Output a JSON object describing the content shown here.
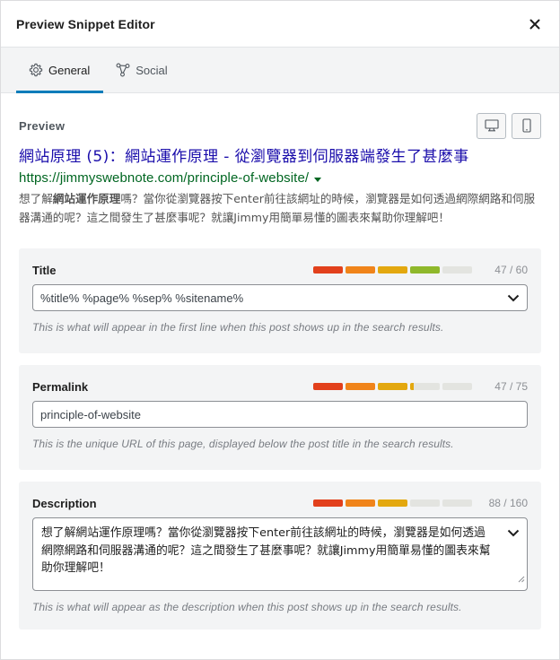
{
  "dialog": {
    "title": "Preview Snippet Editor",
    "close_icon": "close-icon"
  },
  "tabs": [
    {
      "label": "General",
      "icon": "gear-icon",
      "active": true
    },
    {
      "label": "Social",
      "icon": "share-icon",
      "active": false
    }
  ],
  "preview": {
    "label": "Preview",
    "desktop_icon": "desktop-icon",
    "mobile_icon": "mobile-icon",
    "serp": {
      "title": "網站原理 (5)：網站運作原理 - 從瀏覽器到伺服器端發生了甚麼事",
      "url": "https://jimmyswebnote.com/principle-of-website/",
      "desc_prefix": "想了解",
      "desc_bold": "網站運作原理",
      "desc_suffix": "嗎？當你從瀏覽器按下enter前往該網址的時候，瀏覽器是如何透過網際網路和伺服器溝通的呢？這之間發生了甚麼事呢？就讓Jimmy用簡單易懂的圖表來幫助你理解吧！"
    }
  },
  "fields": {
    "title": {
      "label": "Title",
      "value": "%title% %page% %sep% %sitename%",
      "counter": "47 / 60",
      "help": "This is what will appear in the first line when this post shows up in the search results.",
      "segments": [
        1,
        1,
        1,
        1,
        0
      ],
      "colors": [
        "#e2401c",
        "#f0841a",
        "#e3a80f",
        "#8fb82b",
        "#e3e4e0"
      ]
    },
    "permalink": {
      "label": "Permalink",
      "value": "principle-of-website",
      "counter": "47 / 75",
      "help": "This is the unique URL of this page, displayed below the post title in the search results.",
      "segments": [
        1,
        1,
        1,
        0.12,
        0
      ],
      "colors": [
        "#e2401c",
        "#f0841a",
        "#e3a80f",
        "#e3a80f",
        "#e3e4e0"
      ]
    },
    "description": {
      "label": "Description",
      "value": "想了解網站運作原理嗎？當你從瀏覽器按下enter前往該網址的時候，瀏覽器是如何透過網際網路和伺服器溝通的呢？這之間發生了甚麼事呢？就讓Jimmy用簡單易懂的圖表來幫助你理解吧！",
      "counter": "88 / 160",
      "help": "This is what will appear as the description when this post shows up in the search results.",
      "segments": [
        1,
        1,
        1,
        0,
        0
      ],
      "colors": [
        "#e2401c",
        "#f0841a",
        "#e3a80f",
        "#e3e4e0",
        "#e3e4e0"
      ]
    }
  }
}
